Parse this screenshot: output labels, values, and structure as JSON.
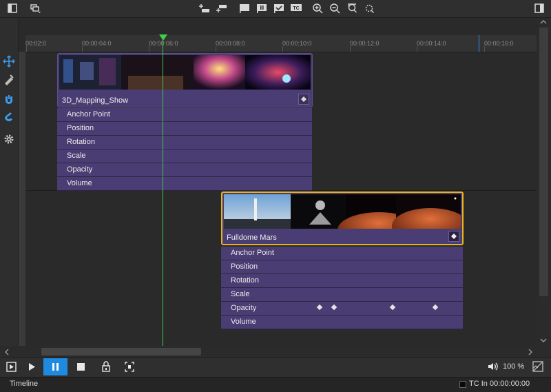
{
  "ruler": {
    "ticks": [
      "00:02:0",
      "00:00:04:0",
      "00:00:06:0",
      "00:00:08:0",
      "00:00:10:0",
      "00:00:12:0",
      "00:00:14:0",
      "00:00:16:0"
    ]
  },
  "clips": [
    {
      "name": "3D_Mapping_Show",
      "properties": [
        "Anchor Point",
        "Position",
        "Rotation",
        "Scale",
        "Opacity",
        "Volume"
      ]
    },
    {
      "name": "Fulldome Mars",
      "properties": [
        "Anchor Point",
        "Position",
        "Rotation",
        "Scale",
        "Opacity",
        "Volume"
      ],
      "selected": true
    }
  ],
  "transport": {
    "volume": "100 %"
  },
  "status": {
    "panel_title": "Timeline",
    "tc_label": "TC In",
    "tc_value": "00:00:00:00"
  },
  "colors": {
    "clip": "#4a3d73",
    "selected_border": "#e8b21c",
    "playhead": "#3fcf4a",
    "active_button": "#1e8be0"
  }
}
